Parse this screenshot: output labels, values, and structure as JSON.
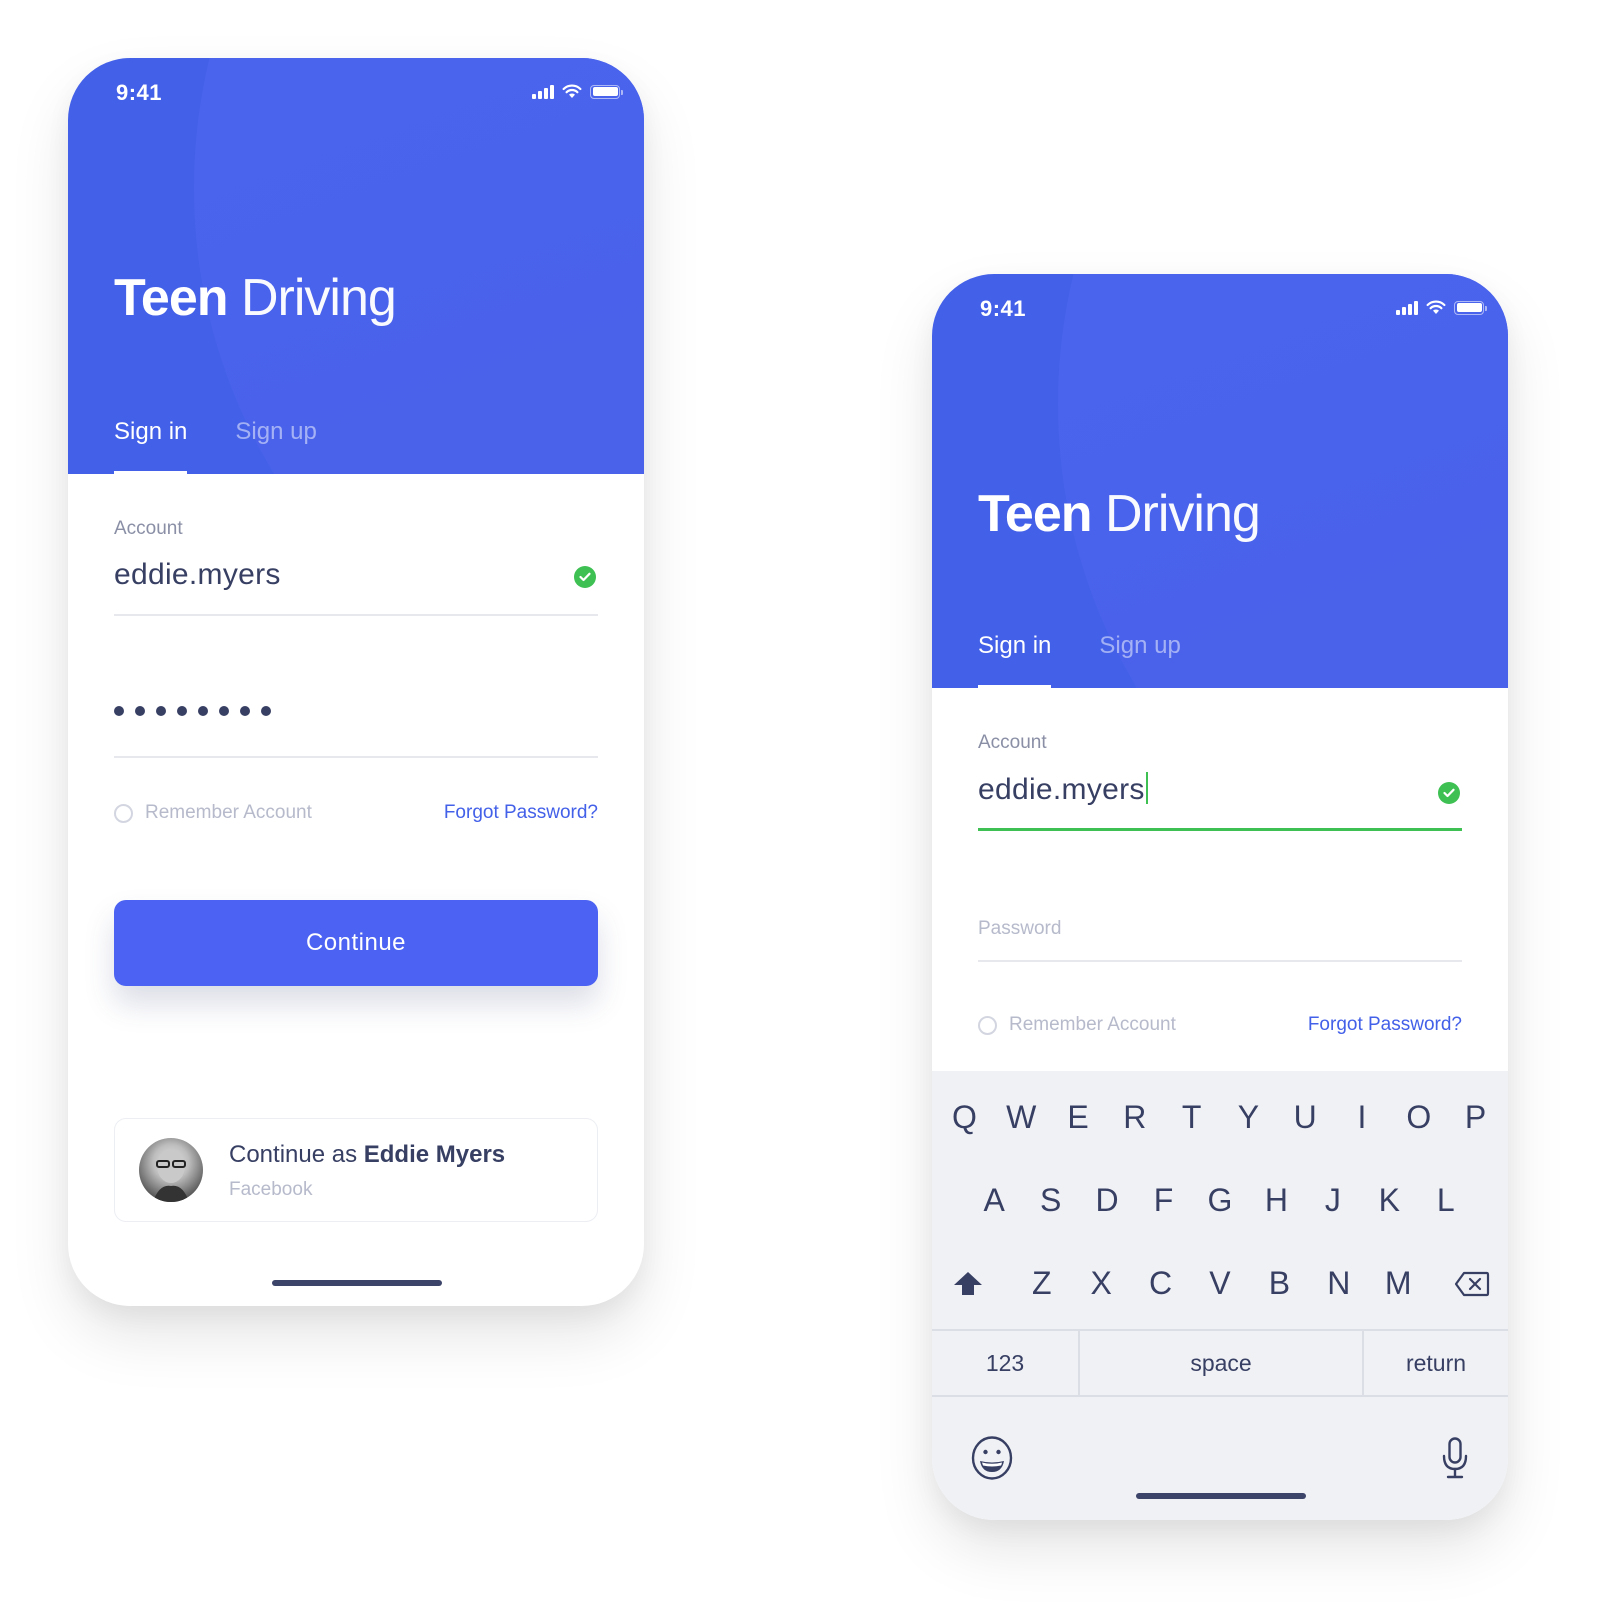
{
  "phones": {
    "left": {
      "status": {
        "time": "9:41"
      },
      "header": {
        "title_bold": "Teen",
        "title_light": "Driving"
      },
      "tabs": [
        {
          "label": "Sign in",
          "active": true
        },
        {
          "label": "Sign up",
          "active": false
        }
      ],
      "account": {
        "label": "Account",
        "value": "eddie.myers",
        "valid": true
      },
      "password": {
        "masked_length": 8
      },
      "remember": {
        "label": "Remember Account",
        "checked": false
      },
      "forgot_label": "Forgot Password?",
      "continue_label": "Continue",
      "social": {
        "prefix": "Continue as ",
        "name": "Eddie Myers",
        "provider": "Facebook"
      }
    },
    "right": {
      "status": {
        "time": "9:41"
      },
      "header": {
        "title_bold": "Teen",
        "title_light": "Driving"
      },
      "tabs": [
        {
          "label": "Sign in",
          "active": true
        },
        {
          "label": "Sign up",
          "active": false
        }
      ],
      "account": {
        "label": "Account",
        "value": "eddie.myers",
        "valid": true,
        "focused": true
      },
      "password": {
        "placeholder": "Password"
      },
      "remember": {
        "label": "Remember Account",
        "checked": false
      },
      "forgot_label": "Forgot Password?",
      "keyboard": {
        "row1": [
          "Q",
          "W",
          "E",
          "R",
          "T",
          "Y",
          "U",
          "I",
          "O",
          "P"
        ],
        "row2": [
          "A",
          "S",
          "D",
          "F",
          "G",
          "H",
          "J",
          "K",
          "L"
        ],
        "row3": [
          "Z",
          "X",
          "C",
          "V",
          "B",
          "N",
          "M"
        ],
        "numbers_label": "123",
        "space_label": "space",
        "return_label": "return"
      }
    }
  },
  "colors": {
    "brand": "#4360e8",
    "button": "#4b62f2",
    "success": "#3ec053",
    "text": "#373f63",
    "muted": "#b6bacb"
  }
}
